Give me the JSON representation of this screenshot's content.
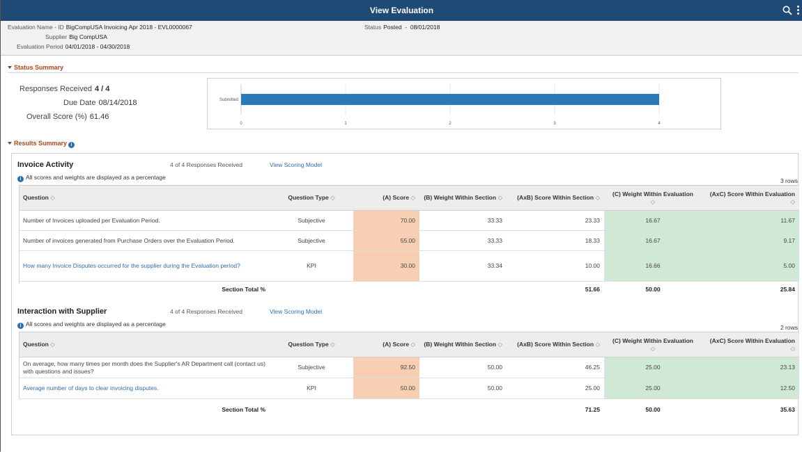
{
  "titlebar": {
    "title": "View Evaluation"
  },
  "header": {
    "eval_label": "Evaluation Name - ID",
    "eval_value": "BigCompUSA Invoicing Apr 2018 - EVL0000067",
    "supplier_label": "Supplier",
    "supplier_value": "Big CompUSA",
    "period_label": "Evaluation Period",
    "period_value": "04/01/2018 - 04/30/2018",
    "status_label": "Status",
    "status_value": "Posted  -  08/01/2018"
  },
  "status_summary": {
    "heading": "Status Summary",
    "responses_label": "Responses Received",
    "responses_value": "4 / 4",
    "due_label": "Due Date",
    "due_value": "08/14/2018",
    "score_label": "Overall Score (%)",
    "score_value": "61.46"
  },
  "chart_data": {
    "type": "bar",
    "orientation": "horizontal",
    "categories": [
      "Submitted"
    ],
    "values": [
      4
    ],
    "xlim": [
      0,
      4
    ],
    "xticks": [
      "0",
      "1",
      "2",
      "3",
      "4"
    ],
    "grid": true,
    "color": "#2a7ab8"
  },
  "results_summary": {
    "heading": "Results Summary",
    "columns": {
      "question": "Question",
      "type": "Question Type",
      "a": "(A) Score",
      "b": "(B) Weight Within Section",
      "axb": "(AxB) Score Within Section",
      "c": "(C) Weight Within Evaluation",
      "axc": "(AxC) Score Within Evaluation"
    },
    "info_text": "All scores and weights are displayed as a percentage",
    "total_label": "Section Total %",
    "groups": [
      {
        "title": "Invoice Activity",
        "responses": "4 of 4 Responses Received",
        "link": "View Scoring Model",
        "rows_count": "3 rows",
        "rows": [
          {
            "question": "Number of Invoices uploaded per Evaluation Period.",
            "type": "Subjective",
            "a": "70.00",
            "b": "33.33",
            "axb": "23.33",
            "c": "16.67",
            "axc": "11.67"
          },
          {
            "question": "Number of invoices generated from Purchase Orders over the Evaluation Period.",
            "type": "Subjective",
            "a": "55.00",
            "b": "33.33",
            "axb": "18.33",
            "c": "16.67",
            "axc": "9.17"
          },
          {
            "question": "How many Invoice Disputes occurred for the supplier during the Evaluation period?",
            "type": "KPI",
            "a": "30.00",
            "b": "33.34",
            "axb": "10.00",
            "c": "16.66",
            "axc": "5.00"
          }
        ],
        "total": {
          "axb": "51.66",
          "c": "50.00",
          "axc": "25.84"
        }
      },
      {
        "title": "Interaction with Supplier",
        "responses": "4 of 4 Responses Received",
        "link": "View Scoring Model",
        "rows_count": "2 rows",
        "rows": [
          {
            "question": "On average, how many times per month does the Supplier's AR Department call (contact us) with questions and issues?",
            "type": "Subjective",
            "a": "92.50",
            "b": "50.00",
            "axb": "46.25",
            "c": "25.00",
            "axc": "23.13"
          },
          {
            "question": "Average number of days to clear invoicing disputes.",
            "type": "KPI",
            "a": "50.00",
            "b": "50.00",
            "axb": "25.00",
            "c": "25.00",
            "axc": "12.50"
          }
        ],
        "total": {
          "axb": "71.25",
          "c": "50.00",
          "axc": "35.63"
        }
      }
    ]
  }
}
